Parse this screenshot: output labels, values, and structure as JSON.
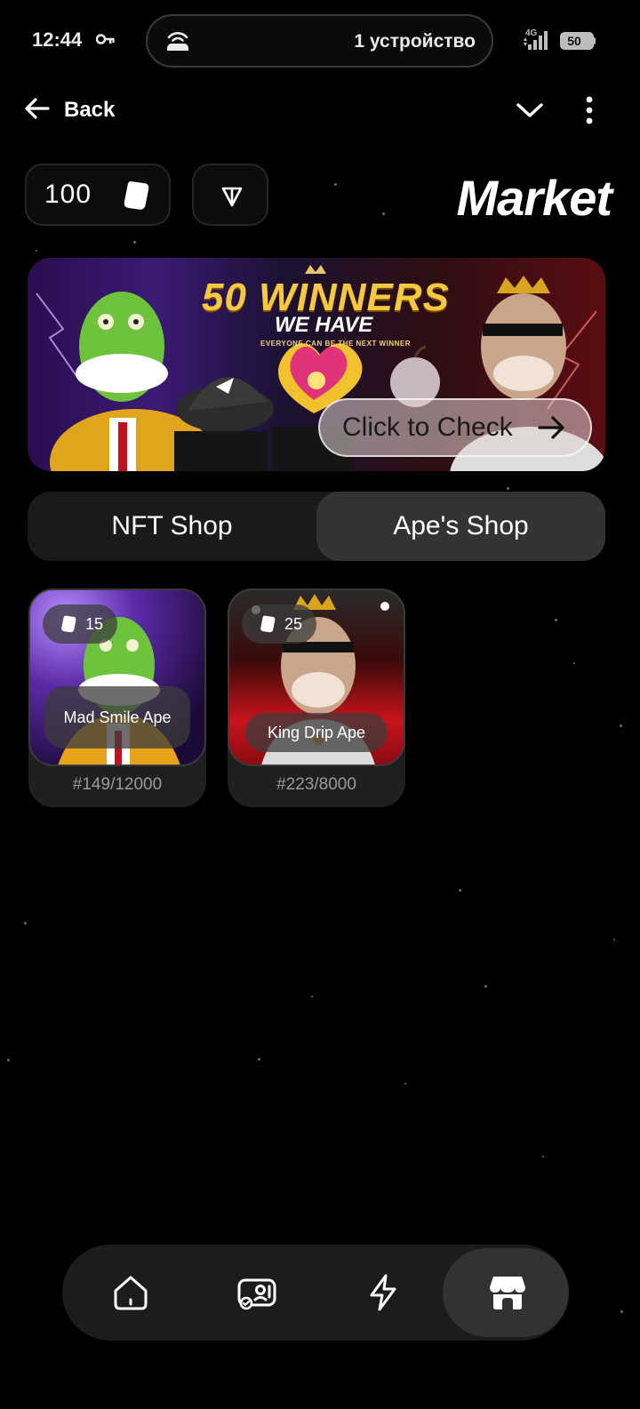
{
  "status_bar": {
    "time": "12:44",
    "hotspot_text": "1 устройство",
    "network": "4G",
    "battery": "50"
  },
  "top_bar": {
    "back_label": "Back"
  },
  "balance": {
    "value": "100"
  },
  "page_title": "Market",
  "banner": {
    "title": "50 WINNERS",
    "subtitle": "WE HAVE",
    "tagline": "EVERYONE CAN BE THE NEXT WINNER",
    "button_label": "Click to Check"
  },
  "tabs": [
    {
      "label": "NFT Shop",
      "active": false
    },
    {
      "label": "Ape's Shop",
      "active": true
    }
  ],
  "cards": [
    {
      "price": "15",
      "name": "Mad Smile Ape",
      "serial": "#149/12000"
    },
    {
      "price": "25",
      "name": "King Drip Ape",
      "serial": "#223/8000"
    }
  ],
  "bottom_nav": [
    {
      "icon": "home-icon"
    },
    {
      "icon": "nft-gallery-icon"
    },
    {
      "icon": "lightning-icon"
    },
    {
      "icon": "store-icon",
      "active": true
    }
  ],
  "colors": {
    "background": "#000000",
    "surface": "#1a1a1a",
    "surface_active": "#333333",
    "text": "#ffffff",
    "muted_text": "#9a9a9a"
  }
}
